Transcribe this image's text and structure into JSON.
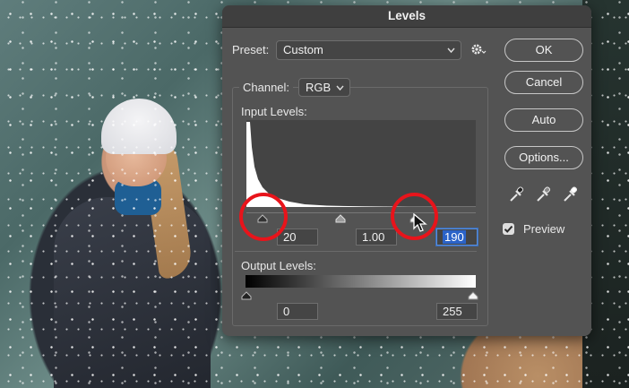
{
  "dialog": {
    "title": "Levels",
    "preset_label": "Preset:",
    "preset_value": "Custom",
    "channel_label": "Channel:",
    "channel_value": "RGB",
    "input_levels_label": "Input Levels:",
    "output_levels_label": "Output Levels:",
    "input_black": "20",
    "input_gamma": "1.00",
    "input_white": "190",
    "output_black": "0",
    "output_white": "255"
  },
  "buttons": {
    "ok": "OK",
    "cancel": "Cancel",
    "auto": "Auto",
    "options": "Options..."
  },
  "preview": {
    "label": "Preview",
    "checked": true
  },
  "icons": [
    "gear-icon",
    "chevron-down-icon",
    "black-eyedropper-icon",
    "gray-eyedropper-icon",
    "white-eyedropper-icon",
    "checkmark-icon",
    "cursor-arrow-icon"
  ],
  "colors": {
    "highlight_ring": "#e8141b",
    "selection": "#2b63c8"
  }
}
